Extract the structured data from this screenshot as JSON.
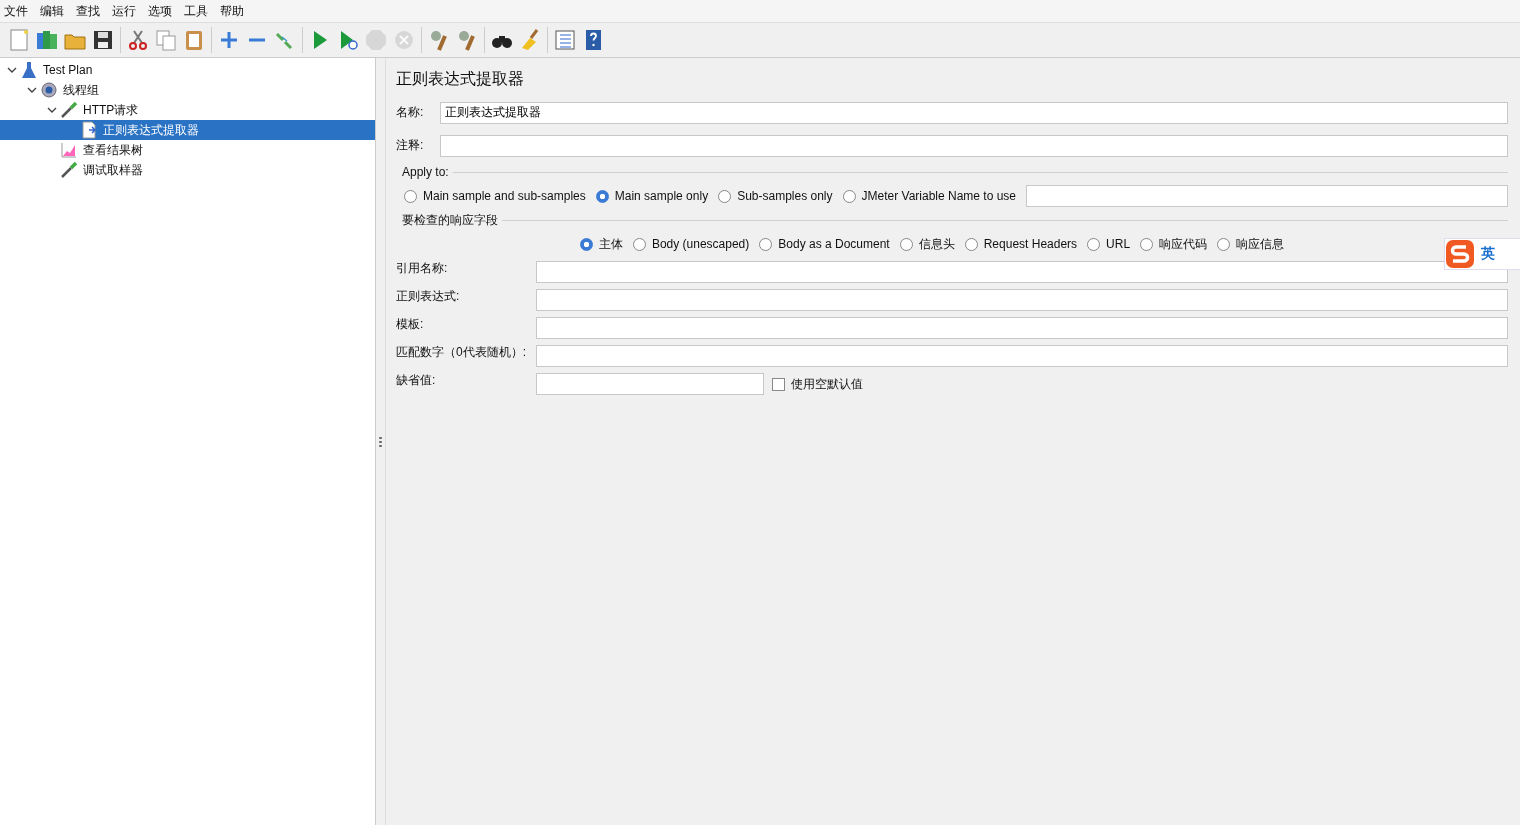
{
  "menu": [
    "文件",
    "编辑",
    "查找",
    "运行",
    "选项",
    "工具",
    "帮助"
  ],
  "toolbar": [
    [
      {
        "kind": "new",
        "disabled": false
      },
      {
        "kind": "templates",
        "disabled": false
      },
      {
        "kind": "open",
        "disabled": false
      },
      {
        "kind": "save",
        "disabled": false
      }
    ],
    [
      {
        "kind": "cut",
        "disabled": false
      },
      {
        "kind": "copy",
        "disabled": false
      },
      {
        "kind": "paste",
        "disabled": false
      }
    ],
    [
      {
        "kind": "expand",
        "disabled": false
      },
      {
        "kind": "collapse",
        "disabled": false
      },
      {
        "kind": "toggle",
        "disabled": false
      }
    ],
    [
      {
        "kind": "start",
        "disabled": false
      },
      {
        "kind": "start-no-pause",
        "disabled": false
      },
      {
        "kind": "stop",
        "disabled": true
      },
      {
        "kind": "shutdown",
        "disabled": true
      }
    ],
    [
      {
        "kind": "clear",
        "disabled": false
      },
      {
        "kind": "clear-all",
        "disabled": false
      }
    ],
    [
      {
        "kind": "search",
        "disabled": false
      },
      {
        "kind": "reset",
        "disabled": false
      }
    ],
    [
      {
        "kind": "list",
        "disabled": false
      },
      {
        "kind": "help",
        "disabled": false
      }
    ]
  ],
  "tree": [
    {
      "label": "Test Plan",
      "kind": "plan",
      "expanded": true,
      "selected": false,
      "children": [
        {
          "label": "线程组",
          "kind": "gear",
          "expanded": true,
          "selected": false,
          "children": [
            {
              "label": "HTTP请求",
              "kind": "sampler",
              "expanded": true,
              "selected": false,
              "children": [
                {
                  "label": "正则表达式提取器",
                  "kind": "extractor",
                  "selected": true
                }
              ]
            },
            {
              "label": "查看结果树",
              "kind": "listener",
              "selected": false
            },
            {
              "label": "调试取样器",
              "kind": "sampler",
              "selected": false
            }
          ]
        }
      ]
    }
  ],
  "panel": {
    "title": "正则表达式提取器",
    "name": {
      "label": "名称:",
      "value": "正则表达式提取器"
    },
    "comment": {
      "label": "注释:"
    },
    "apply_to": {
      "legend": "Apply to:",
      "options": [
        {
          "label": "Main sample and sub-samples",
          "selected": false
        },
        {
          "label": "Main sample only",
          "selected": true
        },
        {
          "label": "Sub-samples only",
          "selected": false
        },
        {
          "label": "JMeter Variable Name to use",
          "selected": false
        }
      ]
    },
    "field_to_check": {
      "legend": "要检查的响应字段",
      "options": [
        {
          "label": "主体",
          "selected": true
        },
        {
          "label": "Body (unescaped)",
          "selected": false
        },
        {
          "label": "Body as a Document",
          "selected": false
        },
        {
          "label": "信息头",
          "selected": false
        },
        {
          "label": "Request Headers",
          "selected": false
        },
        {
          "label": "URL",
          "selected": false
        },
        {
          "label": "响应代码",
          "selected": false
        },
        {
          "label": "响应信息",
          "selected": false
        }
      ]
    },
    "fields": [
      {
        "label": "引用名称:"
      },
      {
        "label": "正则表达式:"
      },
      {
        "label": "模板:"
      },
      {
        "label": "匹配数字（0代表随机）:"
      }
    ],
    "default": {
      "label": "缺省值:",
      "checkbox": {
        "label": "使用空默认值",
        "checked": false
      }
    }
  },
  "ime": {
    "label": "英"
  }
}
